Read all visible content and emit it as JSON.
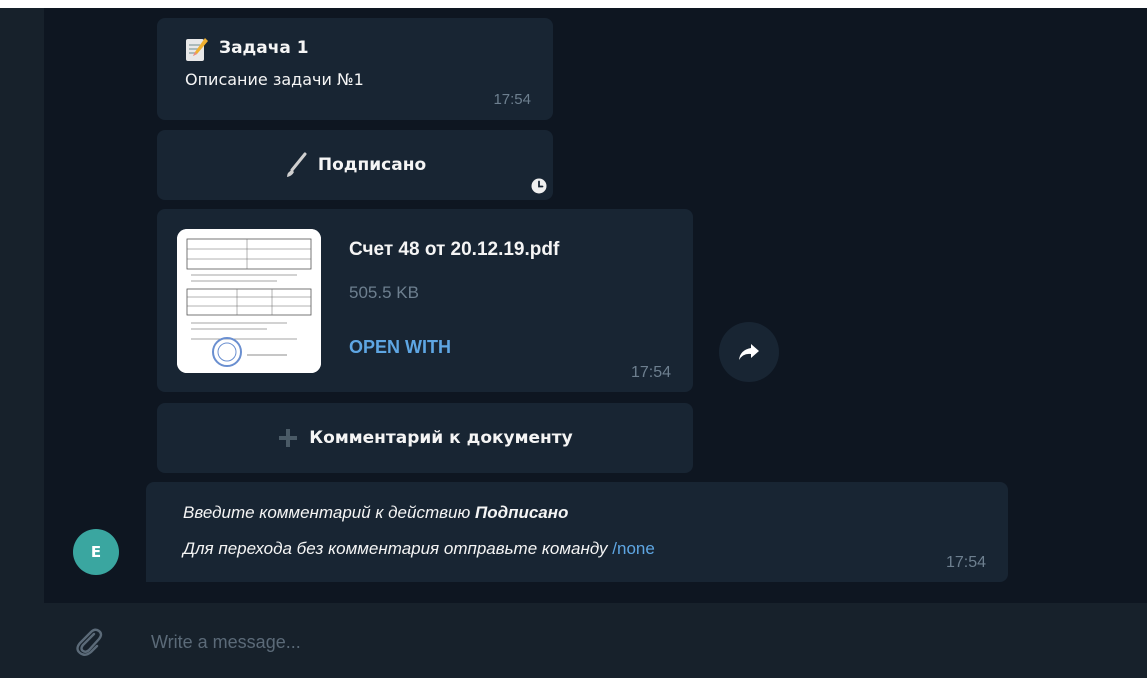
{
  "task": {
    "title": "Задача 1",
    "description": "Описание задачи №1",
    "time": "17:54",
    "icon": "memo-icon"
  },
  "signed_button": {
    "label": "Подписано",
    "icon": "brush-icon",
    "status_icon": "clock-icon"
  },
  "file": {
    "name": "Счет  48 от 20.12.19.pdf",
    "size": "505.5 KB",
    "action": "OPEN WITH",
    "time": "17:54"
  },
  "share": {
    "icon": "share-arrow-icon"
  },
  "comment_button": {
    "label": "Комментарий к документу",
    "icon": "plus-icon"
  },
  "prompt": {
    "line1_prefix": "Введите комментарий к действию ",
    "line1_bold": "Подписано",
    "line2_prefix": "Для перехода без комментария отправьте команду ",
    "command": "/none",
    "time": "17:54",
    "avatar_letter": "E"
  },
  "composer": {
    "placeholder": "Write a message...",
    "attach_icon": "paperclip-icon"
  },
  "colors": {
    "background": "#0e1621",
    "bubble": "#182533",
    "panel": "#17212b",
    "accent": "#5ea6e3",
    "avatar": "#3aa6a0",
    "muted": "#6d7f8f"
  }
}
